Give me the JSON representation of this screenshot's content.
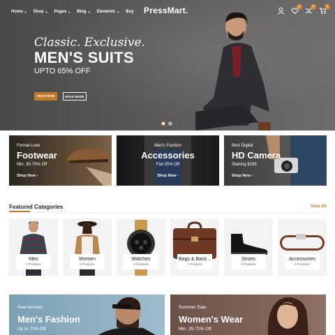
{
  "header": {
    "logo": "PressMart.",
    "nav": [
      {
        "label": "Home",
        "dropdown": true
      },
      {
        "label": "Shop",
        "dropdown": true
      },
      {
        "label": "Pages",
        "dropdown": true
      },
      {
        "label": "Blog",
        "dropdown": true
      },
      {
        "label": "Elements",
        "dropdown": true
      },
      {
        "label": "Buy",
        "dropdown": false
      }
    ],
    "icons": {
      "account": "user-icon",
      "wishlist": "heart-icon",
      "wishlist_count": "0",
      "compare": "shuffle-icon",
      "compare_count": "0",
      "cart": "cart-icon",
      "cart_count": "0"
    }
  },
  "hero": {
    "subtitle": "Classic. Exclusive.",
    "title": "MEN'S SUITS",
    "offer": "UPTO 65% OFF",
    "shop_button": "SHOP NOW",
    "read_button": "READ MORE",
    "slides": 2,
    "active_slide": 1
  },
  "promos": [
    {
      "kicker": "Formal Look",
      "title": "Footwear",
      "subtitle": "Min. 35-70% Off",
      "link": "Shop Now"
    },
    {
      "kicker": "Men's Fashion",
      "title": "Accessories",
      "subtitle": "Flat 25% Off",
      "link": "Shop Now"
    },
    {
      "kicker": "Best Digital",
      "title": "HD Camera",
      "subtitle": "Starting $299",
      "link": "Shop Now"
    }
  ],
  "featured": {
    "title": "Featured Categories",
    "view_all": "View All",
    "categories": [
      {
        "name": "Men",
        "count": "7 Products"
      },
      {
        "name": "Women",
        "count": "6 Products"
      },
      {
        "name": "Watches",
        "count": "4 Products"
      },
      {
        "name": "Bags & Back...",
        "count": "7 Products"
      },
      {
        "name": "Shoes",
        "count": "5 Products"
      },
      {
        "name": "Accessories",
        "count": "3 Products"
      }
    ]
  },
  "banners": [
    {
      "kicker": "New Arrivals",
      "title": "Men's Fashion",
      "subtitle": "Up to 70% Off"
    },
    {
      "kicker": "Summer Sale",
      "title": "Women's Wear",
      "subtitle": "Min. 35-70% Off"
    }
  ],
  "colors": {
    "accent": "#c27a2c",
    "badge": "#d9822b",
    "text": "#222222"
  }
}
